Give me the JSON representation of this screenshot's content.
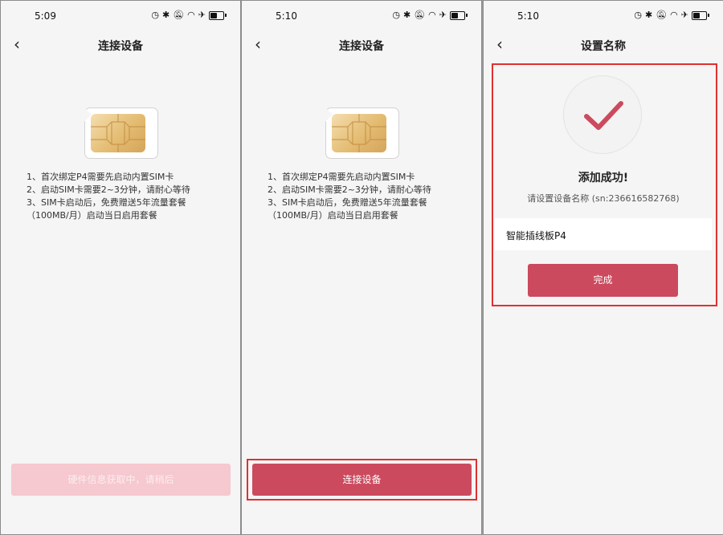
{
  "colors": {
    "accent": "#cc4a5e",
    "disabled": "#f6c8cf",
    "highlight": "#e03030",
    "background": "#f5f5f5"
  },
  "icons": {
    "back": "chevron-left-icon",
    "success": "checkmark-icon",
    "sim": "sim-card-icon"
  },
  "screens": [
    {
      "time": "5:09",
      "title": "连接设备",
      "instructions": [
        "1、首次绑定P4需要先启动内置SIM卡",
        "2、启动SIM卡需要2~3分钟，请耐心等待",
        "3、SIM卡启动后，免费赠送5年流量套餐",
        "（100MB/月）启动当日启用套餐"
      ],
      "button_label": "硬件信息获取中，请稍后"
    },
    {
      "time": "5:10",
      "title": "连接设备",
      "instructions": [
        "1、首次绑定P4需要先启动内置SIM卡",
        "2、启动SIM卡需要2~3分钟，请耐心等待",
        "3、SIM卡启动后，免费赠送5年流量套餐",
        "（100MB/月）启动当日启用套餐"
      ],
      "button_label": "连接设备"
    },
    {
      "time": "5:10",
      "title": "设置名称",
      "success_title": "添加成功!",
      "subtitle": "请设置设备名称 (sn:236616582768)",
      "device_name": "智能插线板P4",
      "done_label": "完成"
    }
  ]
}
